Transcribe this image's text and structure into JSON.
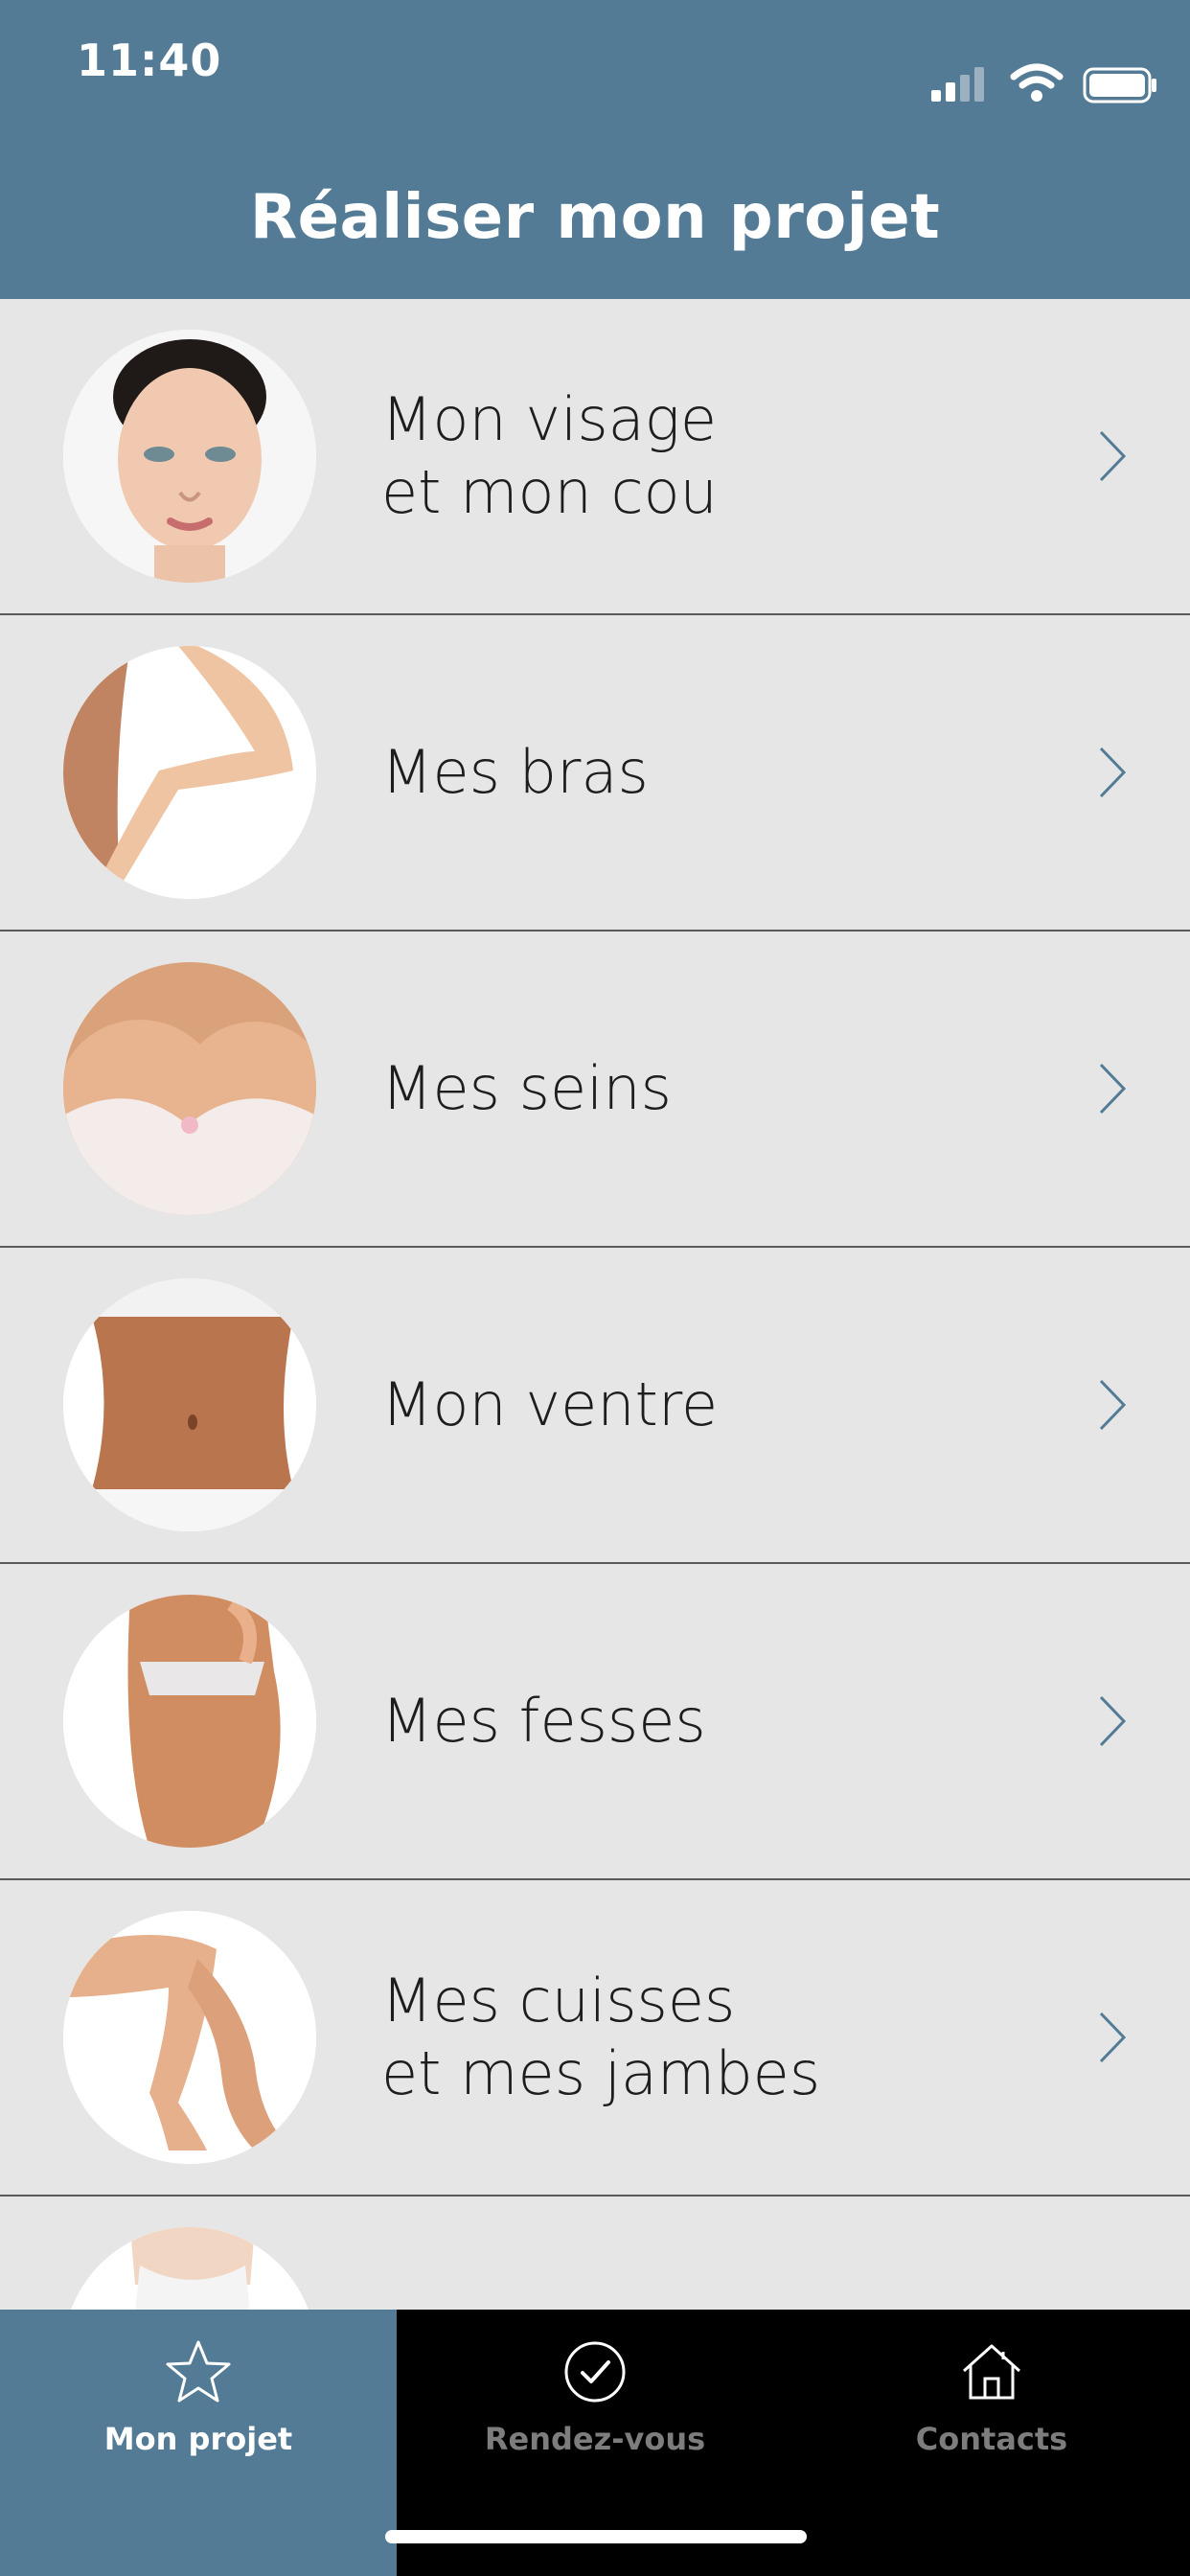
{
  "status_bar": {
    "time": "11:40"
  },
  "header": {
    "title": "Réaliser mon projet"
  },
  "list": {
    "items": [
      {
        "label": "Mon visage\net mon cou",
        "image": "face-photo"
      },
      {
        "label": "Mes bras",
        "image": "arm-photo"
      },
      {
        "label": "Mes seins",
        "image": "bust-photo"
      },
      {
        "label": "Mon ventre",
        "image": "belly-photo"
      },
      {
        "label": "Mes fesses",
        "image": "buttocks-photo"
      },
      {
        "label": "Mes cuisses\net mes jambes",
        "image": "legs-photo"
      },
      {
        "label": "",
        "image": "silhouette-photo"
      }
    ]
  },
  "tabbar": {
    "tabs": [
      {
        "label": "Mon projet",
        "icon": "star-icon",
        "active": true
      },
      {
        "label": "Rendez-vous",
        "icon": "check-circle-icon",
        "active": false
      },
      {
        "label": "Contacts",
        "icon": "home-icon",
        "active": false
      }
    ]
  },
  "colors": {
    "accent": "#537b96",
    "list_bg": "#e6e6e6",
    "tabbar_bg": "#000000"
  }
}
